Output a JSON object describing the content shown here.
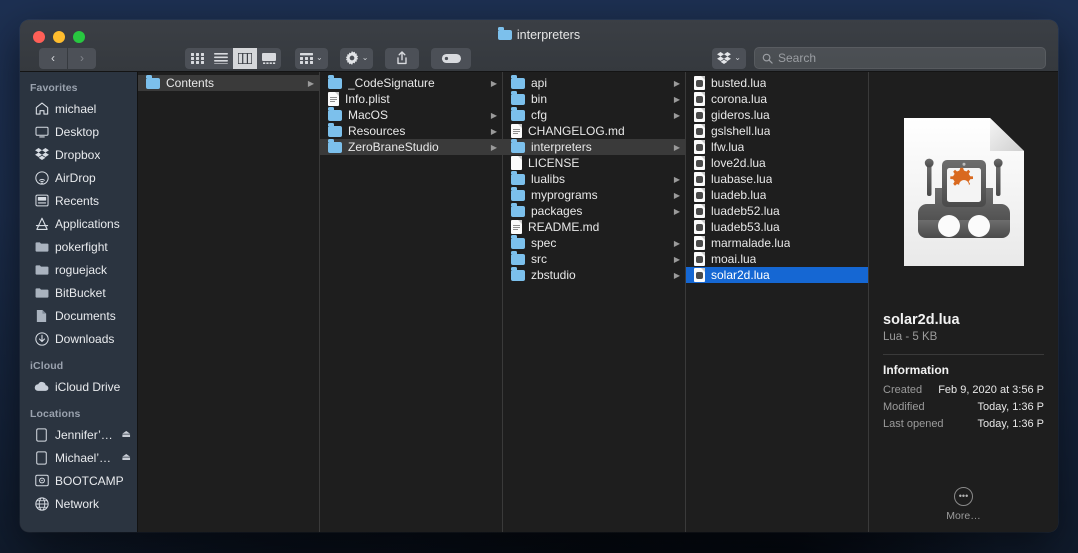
{
  "window": {
    "title": "interpreters",
    "title_icon": "folder-icon",
    "traffic_lights": [
      "close-button",
      "minimize-button",
      "zoom-button"
    ]
  },
  "toolbar": {
    "back_label": "‹",
    "forward_label": "›",
    "view_modes": [
      {
        "name": "icon-view",
        "selected": false
      },
      {
        "name": "list-view",
        "selected": false
      },
      {
        "name": "column-view",
        "selected": true
      },
      {
        "name": "gallery-view",
        "selected": false
      }
    ],
    "group_button": "group-by-button",
    "action_button": "action-gear-button",
    "share_button": "share-button",
    "tags_button": "tags-button",
    "dropbox_button": "dropbox-button",
    "chevron": "⌄"
  },
  "search": {
    "icon": "search-icon",
    "placeholder": "Search",
    "value": ""
  },
  "sidebar": {
    "sections": [
      {
        "header": "Favorites",
        "items": [
          {
            "label": "michael",
            "icon": "home-icon",
            "eject": false
          },
          {
            "label": "Desktop",
            "icon": "desktop-icon",
            "eject": false
          },
          {
            "label": "Dropbox",
            "icon": "dropbox-icon",
            "eject": false
          },
          {
            "label": "AirDrop",
            "icon": "airdrop-icon",
            "eject": false
          },
          {
            "label": "Recents",
            "icon": "recents-icon",
            "eject": false
          },
          {
            "label": "Applications",
            "icon": "applications-icon",
            "eject": false
          },
          {
            "label": "pokerfight",
            "icon": "folder-icon",
            "eject": false
          },
          {
            "label": "roguejack",
            "icon": "folder-icon",
            "eject": false
          },
          {
            "label": "BitBucket",
            "icon": "folder-icon",
            "eject": false
          },
          {
            "label": "Documents",
            "icon": "documents-icon",
            "eject": false
          },
          {
            "label": "Downloads",
            "icon": "downloads-icon",
            "eject": false
          }
        ]
      },
      {
        "header": "iCloud",
        "items": [
          {
            "label": "iCloud Drive",
            "icon": "cloud-icon",
            "eject": false
          }
        ]
      },
      {
        "header": "Locations",
        "items": [
          {
            "label": "Jennifer’…",
            "icon": "device-icon",
            "eject": true
          },
          {
            "label": "Michael’…",
            "icon": "device-icon",
            "eject": true
          },
          {
            "label": "BOOTCAMP",
            "icon": "harddisk-icon",
            "eject": false
          },
          {
            "label": "Network",
            "icon": "network-icon",
            "eject": false
          }
        ]
      }
    ]
  },
  "columns": [
    {
      "name": "column-1",
      "rows": [
        {
          "label": "Contents",
          "icon": "folder-icon",
          "arrow": true,
          "state": "selected-inactive"
        }
      ]
    },
    {
      "name": "column-2",
      "rows": [
        {
          "label": "_CodeSignature",
          "icon": "folder-icon",
          "arrow": true,
          "state": "normal"
        },
        {
          "label": "Info.plist",
          "icon": "document-icon",
          "arrow": false,
          "state": "normal"
        },
        {
          "label": "MacOS",
          "icon": "folder-icon",
          "arrow": true,
          "state": "normal"
        },
        {
          "label": "Resources",
          "icon": "folder-icon",
          "arrow": true,
          "state": "normal"
        },
        {
          "label": "ZeroBraneStudio",
          "icon": "folder-icon",
          "arrow": true,
          "state": "selected-inactive"
        }
      ]
    },
    {
      "name": "column-3",
      "rows": [
        {
          "label": "api",
          "icon": "folder-icon",
          "arrow": true,
          "state": "normal"
        },
        {
          "label": "bin",
          "icon": "folder-icon",
          "arrow": true,
          "state": "normal"
        },
        {
          "label": "cfg",
          "icon": "folder-icon",
          "arrow": true,
          "state": "normal"
        },
        {
          "label": "CHANGELOG.md",
          "icon": "document-icon",
          "arrow": false,
          "state": "normal"
        },
        {
          "label": "interpreters",
          "icon": "folder-icon",
          "arrow": true,
          "state": "selected-inactive"
        },
        {
          "label": "LICENSE",
          "icon": "blank-document-icon",
          "arrow": false,
          "state": "normal"
        },
        {
          "label": "lualibs",
          "icon": "folder-icon",
          "arrow": true,
          "state": "normal"
        },
        {
          "label": "myprograms",
          "icon": "folder-icon",
          "arrow": true,
          "state": "normal"
        },
        {
          "label": "packages",
          "icon": "folder-icon",
          "arrow": true,
          "state": "normal"
        },
        {
          "label": "README.md",
          "icon": "document-icon",
          "arrow": false,
          "state": "normal"
        },
        {
          "label": "spec",
          "icon": "folder-icon",
          "arrow": true,
          "state": "normal"
        },
        {
          "label": "src",
          "icon": "folder-icon",
          "arrow": true,
          "state": "normal"
        },
        {
          "label": "zbstudio",
          "icon": "folder-icon",
          "arrow": true,
          "state": "normal"
        }
      ]
    },
    {
      "name": "column-4",
      "rows": [
        {
          "label": "busted.lua",
          "icon": "lua-file-icon",
          "arrow": false,
          "state": "normal"
        },
        {
          "label": "corona.lua",
          "icon": "lua-file-icon",
          "arrow": false,
          "state": "normal"
        },
        {
          "label": "gideros.lua",
          "icon": "lua-file-icon",
          "arrow": false,
          "state": "normal"
        },
        {
          "label": "gslshell.lua",
          "icon": "lua-file-icon",
          "arrow": false,
          "state": "normal"
        },
        {
          "label": "lfw.lua",
          "icon": "lua-file-icon",
          "arrow": false,
          "state": "normal"
        },
        {
          "label": "love2d.lua",
          "icon": "lua-file-icon",
          "arrow": false,
          "state": "normal"
        },
        {
          "label": "luabase.lua",
          "icon": "lua-file-icon",
          "arrow": false,
          "state": "normal"
        },
        {
          "label": "luadeb.lua",
          "icon": "lua-file-icon",
          "arrow": false,
          "state": "normal"
        },
        {
          "label": "luadeb52.lua",
          "icon": "lua-file-icon",
          "arrow": false,
          "state": "normal"
        },
        {
          "label": "luadeb53.lua",
          "icon": "lua-file-icon",
          "arrow": false,
          "state": "normal"
        },
        {
          "label": "marmalade.lua",
          "icon": "lua-file-icon",
          "arrow": false,
          "state": "normal"
        },
        {
          "label": "moai.lua",
          "icon": "lua-file-icon",
          "arrow": false,
          "state": "normal"
        },
        {
          "label": "solar2d.lua",
          "icon": "lua-file-icon",
          "arrow": false,
          "state": "selected"
        }
      ]
    }
  ],
  "preview": {
    "icon": "automator-robot-document-icon",
    "filename": "solar2d.lua",
    "kind_size": "Lua - 5 KB",
    "section_title": "Information",
    "fields": [
      {
        "key": "Created",
        "value": "Feb 9, 2020 at 3:56 P"
      },
      {
        "key": "Modified",
        "value": "Today, 1:36 P"
      },
      {
        "key": "Last opened",
        "value": "Today, 1:36 P"
      }
    ],
    "more_label": "More…",
    "more_icon": "ellipsis-circle-icon"
  },
  "colors": {
    "selection_blue": "#1567d3",
    "selection_gray": "#3a3a3a",
    "folder_blue": "#7cc0ec",
    "sidebar_bg": "#2b3440",
    "window_bg": "#1e1e1e",
    "accent_orange": "#d9691f"
  }
}
